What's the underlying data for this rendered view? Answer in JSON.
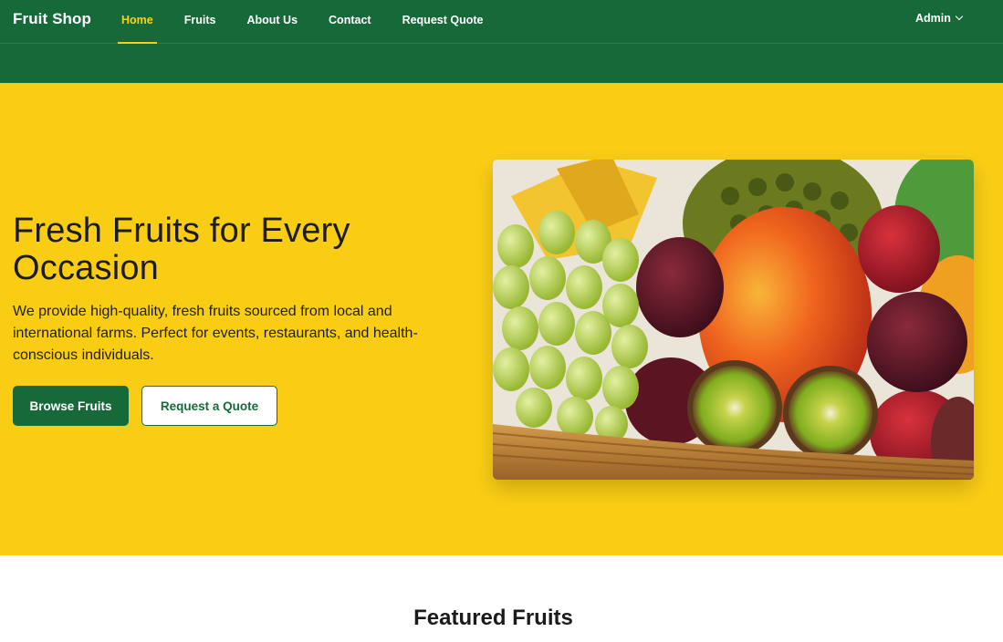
{
  "navbar": {
    "brand": "Fruit Shop",
    "links": [
      {
        "label": "Home",
        "active": true
      },
      {
        "label": "Fruits",
        "active": false
      },
      {
        "label": "About Us",
        "active": false
      },
      {
        "label": "Contact",
        "active": false
      },
      {
        "label": "Request Quote",
        "active": false
      }
    ],
    "user_menu": "Admin",
    "user_menu_icon": "chevron-down-icon"
  },
  "hero": {
    "title": "Fresh Fruits for Every Occasion",
    "description": "We provide high-quality, fresh fruits sourced from local and international farms. Perfect for events, restaurants, and health-conscious individuals.",
    "primary_button": "Browse Fruits",
    "secondary_button": "Request a Quote"
  },
  "featured": {
    "title": "Featured Fruits"
  },
  "colors": {
    "brand_green": "#166a3a",
    "hero_yellow": "#facd15",
    "active_link": "#f8d117"
  }
}
